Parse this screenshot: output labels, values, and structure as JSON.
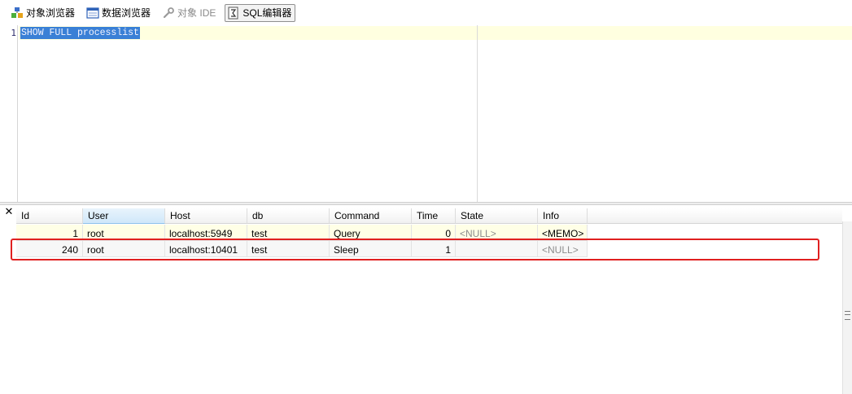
{
  "toolbar": {
    "items": [
      {
        "label": "对象浏览器",
        "icon": "object-browser-icon",
        "state": "normal"
      },
      {
        "label": "数据浏览器",
        "icon": "data-browser-icon",
        "state": "normal"
      },
      {
        "label": "对象 IDE",
        "icon": "wrench-icon",
        "state": "disabled"
      },
      {
        "label": "SQL编辑器",
        "icon": "sql-editor-icon",
        "state": "active"
      }
    ]
  },
  "editor": {
    "line_number": "1",
    "code": "SHOW FULL processlist"
  },
  "results": {
    "close_label": "✕",
    "columns": [
      "Id",
      "User",
      "Host",
      "db",
      "Command",
      "Time",
      "State",
      "Info"
    ],
    "rows": [
      {
        "Id": "1",
        "User": "root",
        "Host": "localhost:5949",
        "db": "test",
        "Command": "Query",
        "Time": "0",
        "State": "<NULL>",
        "Info": "<MEMO>"
      },
      {
        "Id": "240",
        "User": "root",
        "Host": "localhost:10401",
        "db": "test",
        "Command": "Sleep",
        "Time": "1",
        "State": "",
        "Info": "<NULL>"
      }
    ]
  },
  "colors": {
    "selection": "#3a80d6",
    "current_line": "#ffffe0",
    "highlight_border": "#e02020",
    "null_text": "#8c8c8c"
  }
}
